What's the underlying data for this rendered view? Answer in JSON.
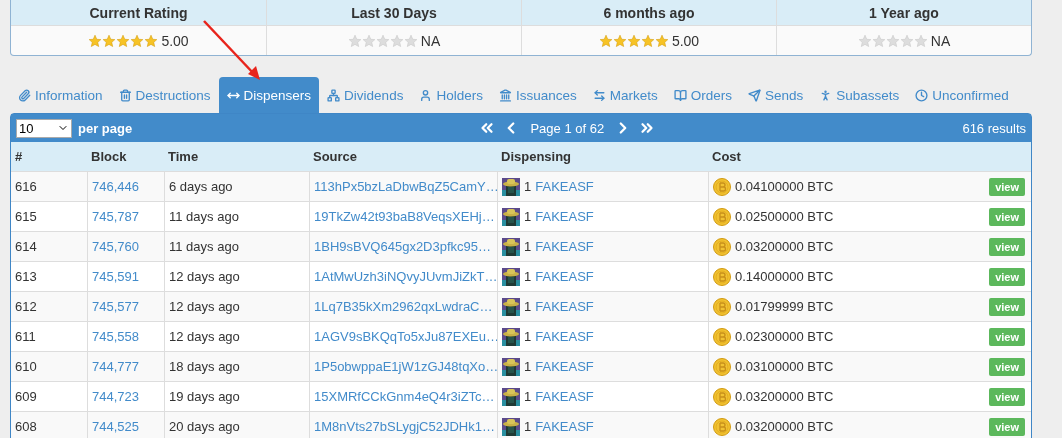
{
  "ratings": [
    {
      "label": "Current Rating",
      "stars": 5,
      "value": "5.00"
    },
    {
      "label": "Last 30 Days",
      "stars": 0,
      "value": "NA"
    },
    {
      "label": "6 months ago",
      "stars": 5,
      "value": "5.00"
    },
    {
      "label": "1 Year ago",
      "stars": 0,
      "value": "NA"
    }
  ],
  "tabs": [
    {
      "label": "Information",
      "selected": false
    },
    {
      "label": "Destructions",
      "selected": false
    },
    {
      "label": "Dispensers",
      "selected": true
    },
    {
      "label": "Dividends",
      "selected": false
    },
    {
      "label": "Holders",
      "selected": false
    },
    {
      "label": "Issuances",
      "selected": false
    },
    {
      "label": "Markets",
      "selected": false
    },
    {
      "label": "Orders",
      "selected": false
    },
    {
      "label": "Sends",
      "selected": false
    },
    {
      "label": "Subassets",
      "selected": false
    },
    {
      "label": "Unconfirmed",
      "selected": false
    }
  ],
  "toolbar": {
    "per_page": "10",
    "per_page_label": "per page",
    "page": "Page 1 of 62",
    "results": "616 results"
  },
  "table": {
    "columns": [
      "#",
      "Block",
      "Time",
      "Source",
      "Dispensing",
      "Cost"
    ],
    "rows": [
      {
        "id": "616",
        "block": "746,446",
        "time": "6 days ago",
        "source": "113hPx5bzLaDbwBqZ5CamY…",
        "qty": "1",
        "asset": "FAKEASF",
        "cost": "0.04100000 BTC",
        "action": "view"
      },
      {
        "id": "615",
        "block": "745,787",
        "time": "11 days ago",
        "source": "19TkZw42t93baB8VeqsXEHj…",
        "qty": "1",
        "asset": "FAKEASF",
        "cost": "0.02500000 BTC",
        "action": "view"
      },
      {
        "id": "614",
        "block": "745,760",
        "time": "11 days ago",
        "source": "1BH9sBVQ645gx2D3pfkc95…",
        "qty": "1",
        "asset": "FAKEASF",
        "cost": "0.03200000 BTC",
        "action": "view"
      },
      {
        "id": "613",
        "block": "745,591",
        "time": "12 days ago",
        "source": "1AtMwUzh3iNQvyJUvmJiZkT…",
        "qty": "1",
        "asset": "FAKEASF",
        "cost": "0.14000000 BTC",
        "action": "view"
      },
      {
        "id": "612",
        "block": "745,577",
        "time": "12 days ago",
        "source": "1Lq7B35kXm2962qxLwdraC…",
        "qty": "1",
        "asset": "FAKEASF",
        "cost": "0.01799999 BTC",
        "action": "view"
      },
      {
        "id": "611",
        "block": "745,558",
        "time": "12 days ago",
        "source": "1AGV9sBKQqTo5xJu87EXEu…",
        "qty": "1",
        "asset": "FAKEASF",
        "cost": "0.02300000 BTC",
        "action": "view"
      },
      {
        "id": "610",
        "block": "744,777",
        "time": "18 days ago",
        "source": "1P5obwppaE1jW1zGJ48tqXo…",
        "qty": "1",
        "asset": "FAKEASF",
        "cost": "0.03100000 BTC",
        "action": "view"
      },
      {
        "id": "609",
        "block": "744,723",
        "time": "19 days ago",
        "source": "15XMRfCCkGnm4eQ4r3iZTc…",
        "qty": "1",
        "asset": "FAKEASF",
        "cost": "0.03200000 BTC",
        "action": "view"
      },
      {
        "id": "608",
        "block": "744,525",
        "time": "20 days ago",
        "source": "1M8nVts27bSLygjC52JDHk1…",
        "qty": "1",
        "asset": "FAKEASF",
        "cost": "0.03200000 BTC",
        "action": "view"
      }
    ]
  }
}
